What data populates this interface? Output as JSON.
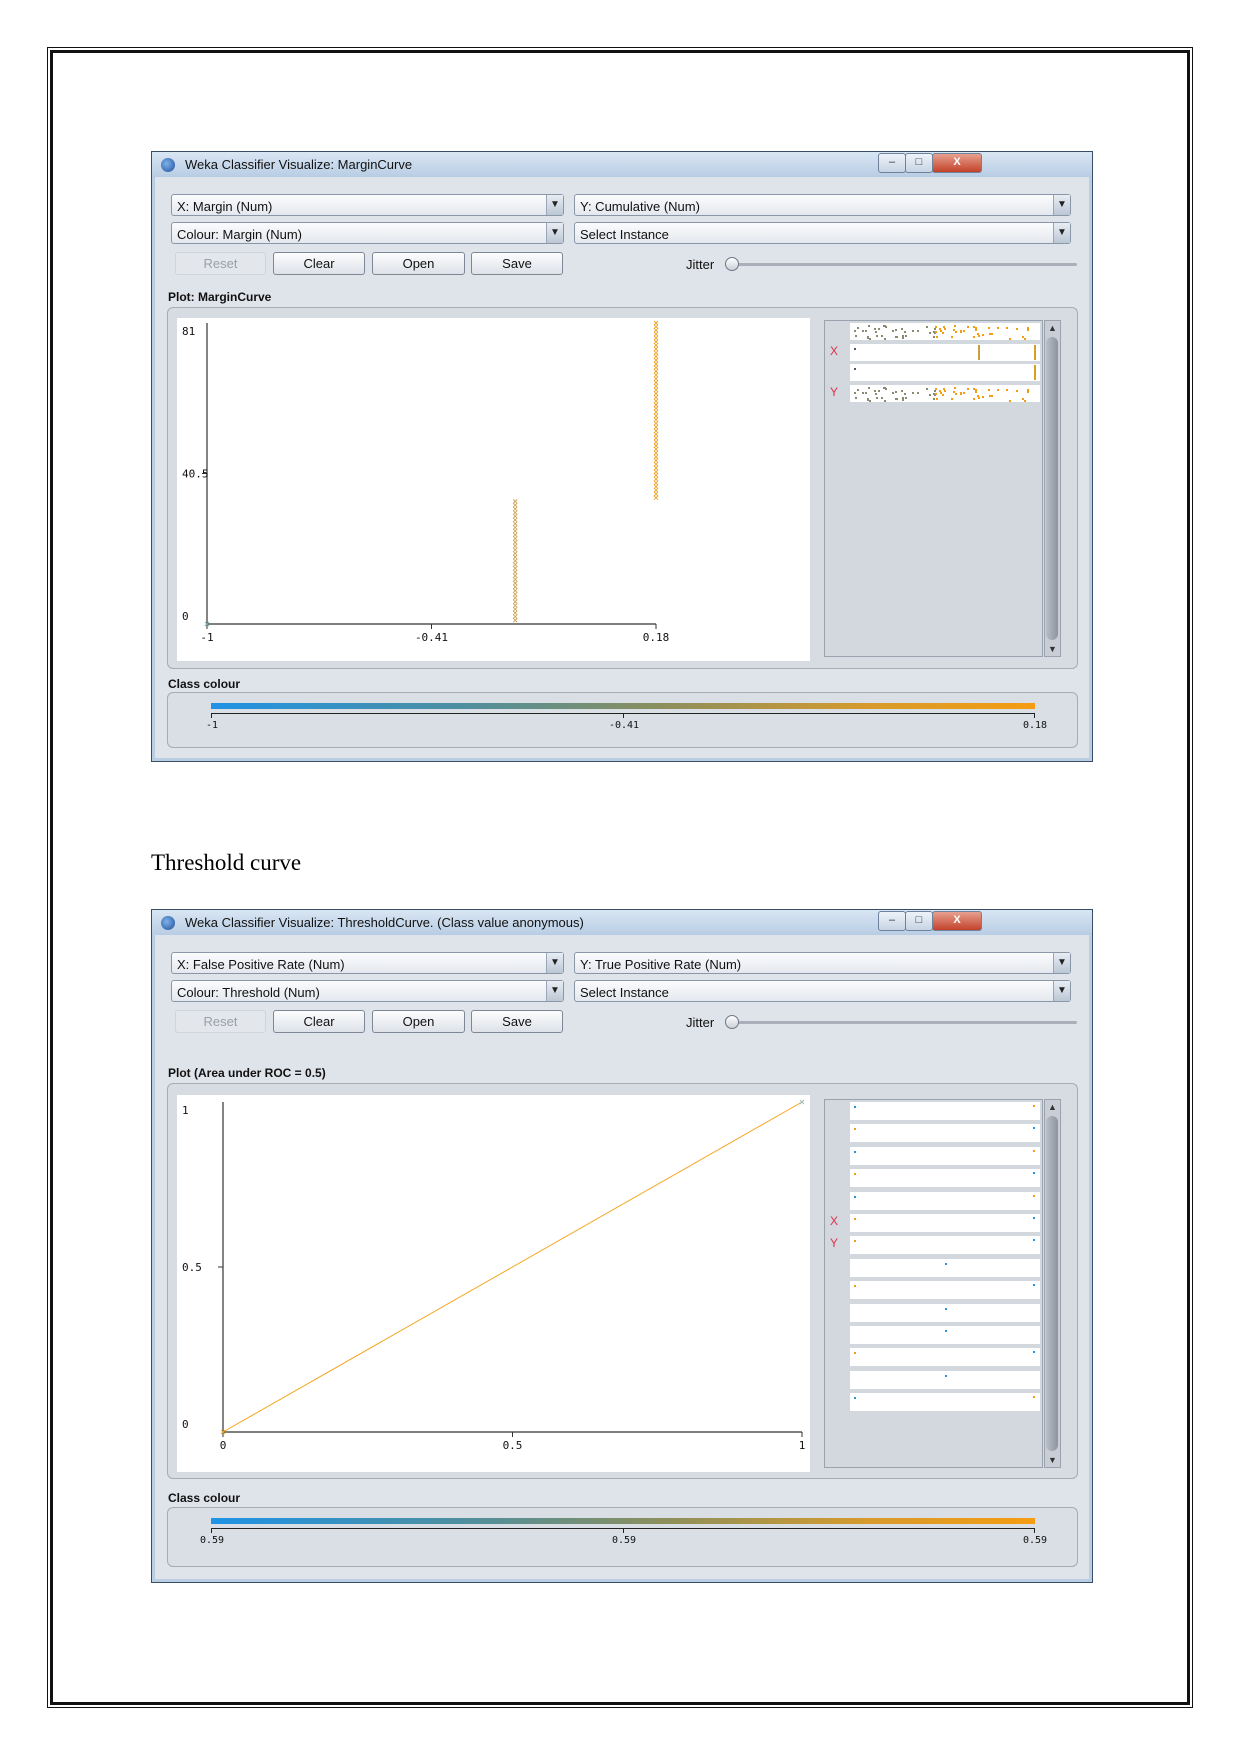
{
  "heading": "Threshold curve",
  "colors": {
    "low": "#1f93e6",
    "high": "#f59c12",
    "axis_label": "#e0304a"
  },
  "windows": [
    {
      "title": "Weka Classifier Visualize: MarginCurve",
      "x_combo": "X: Margin (Num)",
      "y_combo": "Y: Cumulative (Num)",
      "colour_combo": "Colour: Margin (Num)",
      "select_combo": "Select Instance",
      "buttons": {
        "reset": "Reset",
        "clear": "Clear",
        "open": "Open",
        "save": "Save"
      },
      "jitter_label": "Jitter",
      "jitter_value": 0,
      "plot_label": "Plot: MarginCurve",
      "attr_x": "X",
      "attr_y": "Y",
      "class_colour_label": "Class colour",
      "class_colour_ticks": [
        "-1",
        "-0.41",
        "0.18"
      ],
      "window_buttons": {
        "minimize": "–",
        "maximize": "□",
        "close": "X"
      }
    },
    {
      "title": "Weka Classifier Visualize: ThresholdCurve. (Class value anonymous)",
      "x_combo": "X: False Positive Rate (Num)",
      "y_combo": "Y: True Positive Rate (Num)",
      "colour_combo": "Colour: Threshold (Num)",
      "select_combo": "Select Instance",
      "buttons": {
        "reset": "Reset",
        "clear": "Clear",
        "open": "Open",
        "save": "Save"
      },
      "jitter_label": "Jitter",
      "jitter_value": 0,
      "plot_label": "Plot (Area under ROC = 0.5)",
      "attr_x": "X",
      "attr_y": "Y",
      "class_colour_label": "Class colour",
      "class_colour_ticks": [
        "0.59",
        "0.59",
        "0.59"
      ],
      "window_buttons": {
        "minimize": "–",
        "maximize": "□",
        "close": "X"
      }
    }
  ],
  "chart_data": [
    {
      "type": "scatter",
      "xlabel": "",
      "ylabel": "",
      "xlim": [
        -1,
        0.18
      ],
      "ylim": [
        0,
        81
      ],
      "xticks": [
        "-1",
        "-0.41",
        "0.18"
      ],
      "yticks": [
        "0",
        "40.5",
        "81"
      ],
      "grid": false,
      "marker": "x",
      "series": [
        {
          "x": -1,
          "y_from": 0,
          "y_to": 0
        },
        {
          "x": -0.19,
          "y_from": 1,
          "y_to": 33
        },
        {
          "x": 0.18,
          "y_from": 34,
          "y_to": 81
        }
      ]
    },
    {
      "type": "line",
      "xlabel": "",
      "ylabel": "",
      "xlim": [
        0,
        1
      ],
      "ylim": [
        0,
        1
      ],
      "xticks": [
        "0",
        "0.5",
        "1"
      ],
      "yticks": [
        "0",
        "0.5",
        "1"
      ],
      "grid": false,
      "series": [
        {
          "x": [
            0,
            1
          ],
          "y": [
            0,
            1
          ],
          "color": "#f5a623"
        }
      ]
    }
  ]
}
